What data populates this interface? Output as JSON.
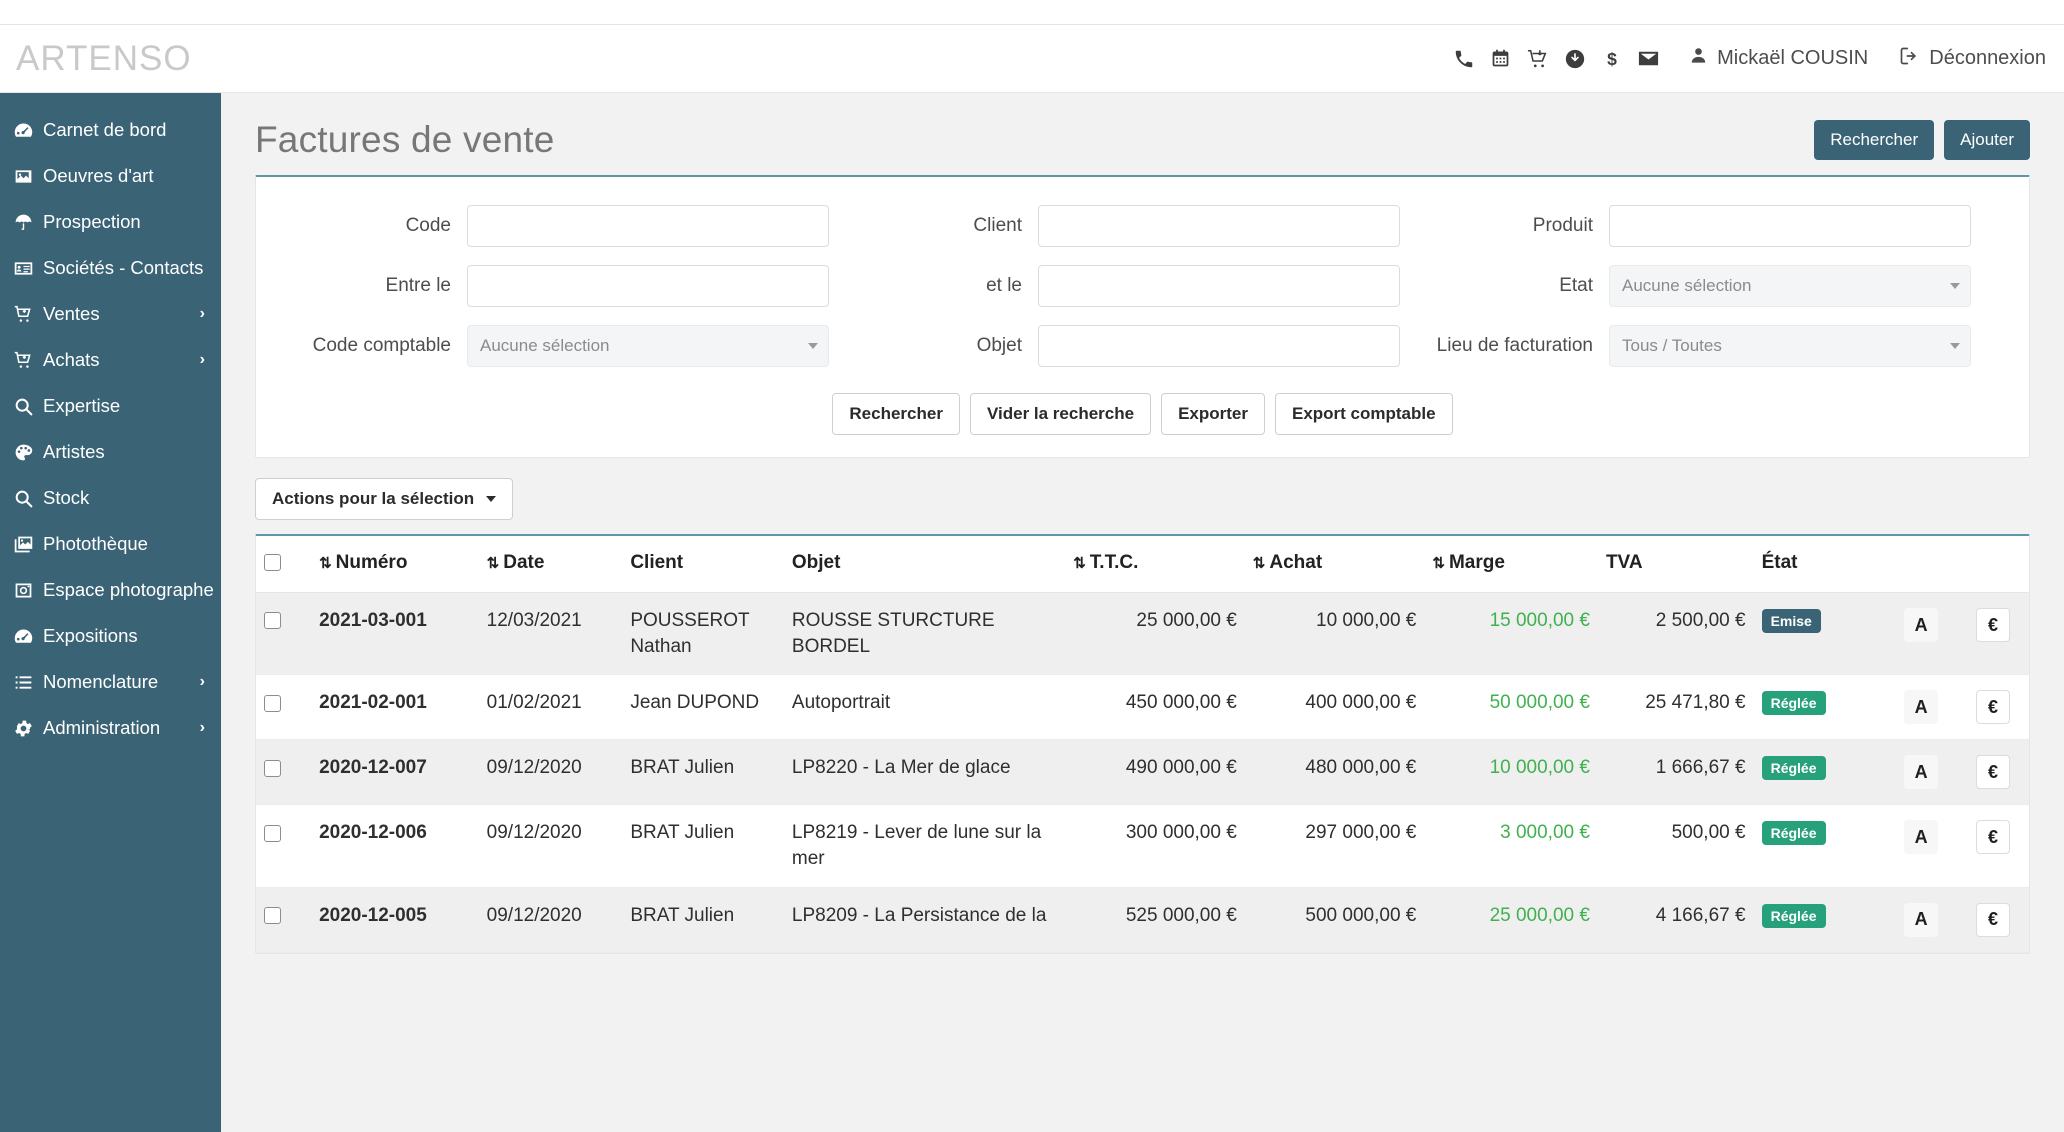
{
  "brand": "ARTENSO",
  "header": {
    "icons": [
      "phone-icon",
      "calendar-icon",
      "cart-icon",
      "download-circle-icon",
      "dollar-icon",
      "envelope-icon"
    ],
    "user_name": "Mickaël COUSIN",
    "logout_label": "Déconnexion"
  },
  "sidebar": {
    "items": [
      {
        "label": "Carnet de bord",
        "icon": "dashboard-icon",
        "caret": ""
      },
      {
        "label": "Oeuvres d'art",
        "icon": "image-icon",
        "caret": ""
      },
      {
        "label": "Prospection",
        "icon": "umbrella-icon",
        "caret": ""
      },
      {
        "label": "Sociétés - Contacts",
        "icon": "id-card-icon",
        "caret": ""
      },
      {
        "label": "Ventes",
        "icon": "cart-icon",
        "caret": "›"
      },
      {
        "label": "Achats",
        "icon": "cart-icon",
        "caret": "›"
      },
      {
        "label": "Expertise",
        "icon": "search-icon",
        "caret": ""
      },
      {
        "label": "Artistes",
        "icon": "palette-icon",
        "caret": ""
      },
      {
        "label": "Stock",
        "icon": "search-icon",
        "caret": ""
      },
      {
        "label": "Photothèque",
        "icon": "images-icon",
        "caret": ""
      },
      {
        "label": "Espace photographe",
        "icon": "camera-icon",
        "caret": ""
      },
      {
        "label": "Expositions",
        "icon": "dashboard-icon",
        "caret": ""
      },
      {
        "label": "Nomenclature",
        "icon": "list-icon",
        "caret": "›"
      },
      {
        "label": "Administration",
        "icon": "gear-icon",
        "caret": "›"
      }
    ]
  },
  "page": {
    "title": "Factures de vente",
    "search_button": "Rechercher",
    "add_button": "Ajouter"
  },
  "search_form": {
    "fields": [
      {
        "label": "Code",
        "type": "text",
        "value": "",
        "placeholder": ""
      },
      {
        "label": "Client",
        "type": "text",
        "value": "",
        "placeholder": ""
      },
      {
        "label": "Produit",
        "type": "text",
        "value": "",
        "placeholder": ""
      },
      {
        "label": "Entre le",
        "type": "text",
        "value": "",
        "placeholder": ""
      },
      {
        "label": "et le",
        "type": "text",
        "value": "",
        "placeholder": ""
      },
      {
        "label": "Etat",
        "type": "select",
        "value": "Aucune sélection"
      },
      {
        "label": "Code comptable",
        "type": "select",
        "value": "Aucune sélection"
      },
      {
        "label": "Objet",
        "type": "text",
        "value": "",
        "placeholder": ""
      },
      {
        "label": "Lieu de facturation",
        "type": "select",
        "value": "Tous / Toutes"
      }
    ],
    "buttons": [
      "Rechercher",
      "Vider la recherche",
      "Exporter",
      "Export comptable"
    ]
  },
  "selection": {
    "actions_label": "Actions pour la sélection"
  },
  "table": {
    "columns": [
      {
        "label": "",
        "sortable": false
      },
      {
        "label": "Numéro",
        "sortable": true
      },
      {
        "label": "Date",
        "sortable": true
      },
      {
        "label": "Client",
        "sortable": false
      },
      {
        "label": "Objet",
        "sortable": false
      },
      {
        "label": "T.T.C.",
        "sortable": true
      },
      {
        "label": "Achat",
        "sortable": true
      },
      {
        "label": "Marge",
        "sortable": true
      },
      {
        "label": "TVA",
        "sortable": false
      },
      {
        "label": "État",
        "sortable": false
      },
      {
        "label": "",
        "sortable": false
      },
      {
        "label": "",
        "sortable": false
      }
    ],
    "rows": [
      {
        "numero": "2021-03-001",
        "date": "12/03/2021",
        "client": "POUSSEROT Nathan",
        "objet": "ROUSSE STURCTURE BORDEL",
        "ttc": "25 000,00 €",
        "achat": "10 000,00 €",
        "marge": "15 000,00 €",
        "tva": "2 500,00 €",
        "etat": "Emise",
        "etat_type": "emise",
        "action_a": "A",
        "action_euro": "€"
      },
      {
        "numero": "2021-02-001",
        "date": "01/02/2021",
        "client": "Jean DUPOND",
        "objet": "Autoportrait",
        "ttc": "450 000,00 €",
        "achat": "400 000,00 €",
        "marge": "50 000,00 €",
        "tva": "25 471,80 €",
        "etat": "Réglée",
        "etat_type": "reglee",
        "action_a": "A",
        "action_euro": "€"
      },
      {
        "numero": "2020-12-007",
        "date": "09/12/2020",
        "client": "BRAT Julien",
        "objet": "LP8220 - La Mer de glace",
        "ttc": "490 000,00 €",
        "achat": "480 000,00 €",
        "marge": "10 000,00 €",
        "tva": "1 666,67 €",
        "etat": "Réglée",
        "etat_type": "reglee",
        "action_a": "A",
        "action_euro": "€"
      },
      {
        "numero": "2020-12-006",
        "date": "09/12/2020",
        "client": "BRAT Julien",
        "objet": "LP8219 - Lever de lune sur la mer",
        "ttc": "300 000,00 €",
        "achat": "297 000,00 €",
        "marge": "3 000,00 €",
        "tva": "500,00 €",
        "etat": "Réglée",
        "etat_type": "reglee",
        "action_a": "A",
        "action_euro": "€"
      },
      {
        "numero": "2020-12-005",
        "date": "09/12/2020",
        "client": "BRAT Julien",
        "objet": "LP8209 - La Persistance de la",
        "ttc": "525 000,00 €",
        "achat": "500 000,00 €",
        "marge": "25 000,00 €",
        "tva": "4 166,67 €",
        "etat": "Réglée",
        "etat_type": "reglee",
        "action_a": "A",
        "action_euro": "€"
      }
    ]
  },
  "colors": {
    "brand_dark": "#3a6375",
    "accent_line": "#5d97a8",
    "marge_green": "#3fb24f",
    "badge_reglee": "#27a17b",
    "badge_emise": "#3a6375"
  }
}
